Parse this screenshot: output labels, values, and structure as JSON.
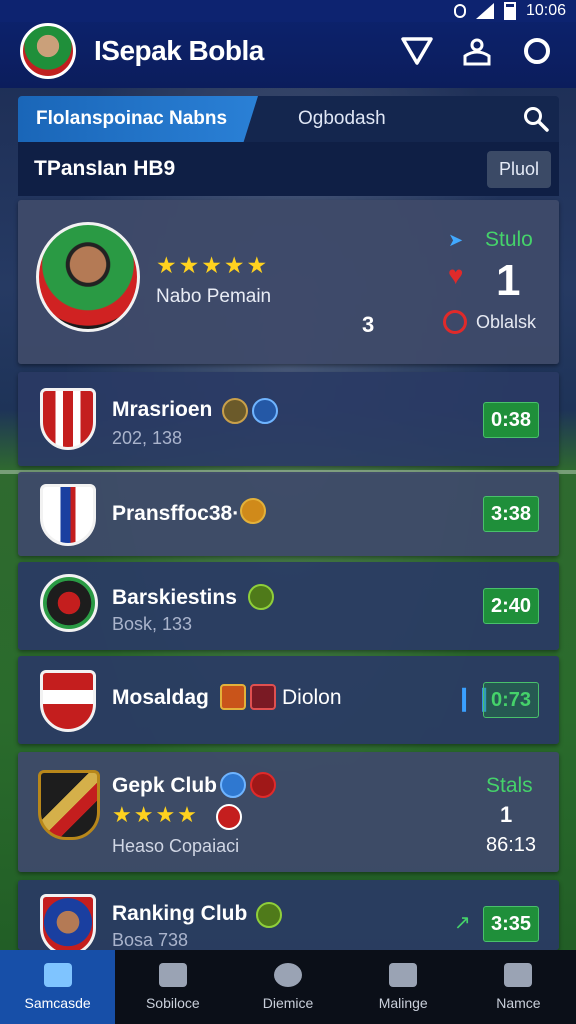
{
  "status_bar": {
    "time": "10:06"
  },
  "header": {
    "title": "ISepak Bobla"
  },
  "tabs": {
    "active": "Flolanspoinac Nabns",
    "inactive": "Ogbodash"
  },
  "section": {
    "label": "TPansIan HB9",
    "button": "Pluol"
  },
  "featured": {
    "stars": "★★★★★",
    "name": "Nabo Pemain",
    "count": "3",
    "status": "Stulo",
    "big_number": "1",
    "download": "Oblalsk"
  },
  "clubs": [
    {
      "name": "Mrasrioen",
      "sub": "202, 138",
      "score": "0:38"
    },
    {
      "name": "Pransffoc38·",
      "sub": "",
      "score": "3:38"
    },
    {
      "name": "Barskiestins",
      "sub": "Bosk, 133",
      "score": "2:40"
    },
    {
      "name": "Mosaldag",
      "extra": "Diolon",
      "score": "0:73"
    },
    {
      "name": "Gepk Club",
      "stars": "★★★★",
      "sub": "Heaso Copaiaci",
      "stats": "Stals",
      "stats_num": "1",
      "score_text": "86:13"
    },
    {
      "name": "Ranking Club",
      "sub": "Bosa 738",
      "score": "3:35"
    }
  ],
  "bottom_nav": [
    "Samcasde",
    "Sobiloce",
    "Diemice",
    "Malinge",
    "Namce"
  ]
}
